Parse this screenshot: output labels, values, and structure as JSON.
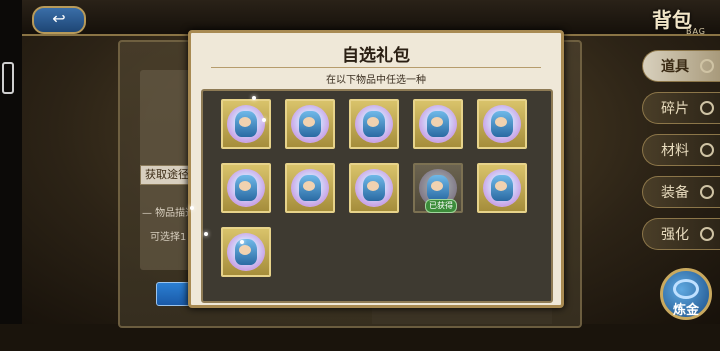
{
  "header": {
    "title": "背包",
    "subtitle": "BAG",
    "back_icon": "back-arrow-icon"
  },
  "side_tabs": [
    {
      "label": "道具",
      "active": true
    },
    {
      "label": "碎片",
      "active": false
    },
    {
      "label": "材料",
      "active": false
    },
    {
      "label": "装备",
      "active": false
    },
    {
      "label": "强化",
      "active": false
    }
  ],
  "refine_button": {
    "label": "炼金"
  },
  "background": {
    "get_route_label": "获取途径",
    "item_info_label": "— 物品描述",
    "selectable_label": "可选择1"
  },
  "dialog": {
    "title": "自选礼包",
    "subtitle": "在以下物品中任选一种",
    "owned_badge": "已获得",
    "items": [
      {
        "owned": false
      },
      {
        "owned": false
      },
      {
        "owned": false
      },
      {
        "owned": false
      },
      {
        "owned": false
      },
      {
        "owned": false
      },
      {
        "owned": false
      },
      {
        "owned": false
      },
      {
        "owned": true
      },
      {
        "owned": false
      },
      {
        "owned": false
      }
    ]
  }
}
